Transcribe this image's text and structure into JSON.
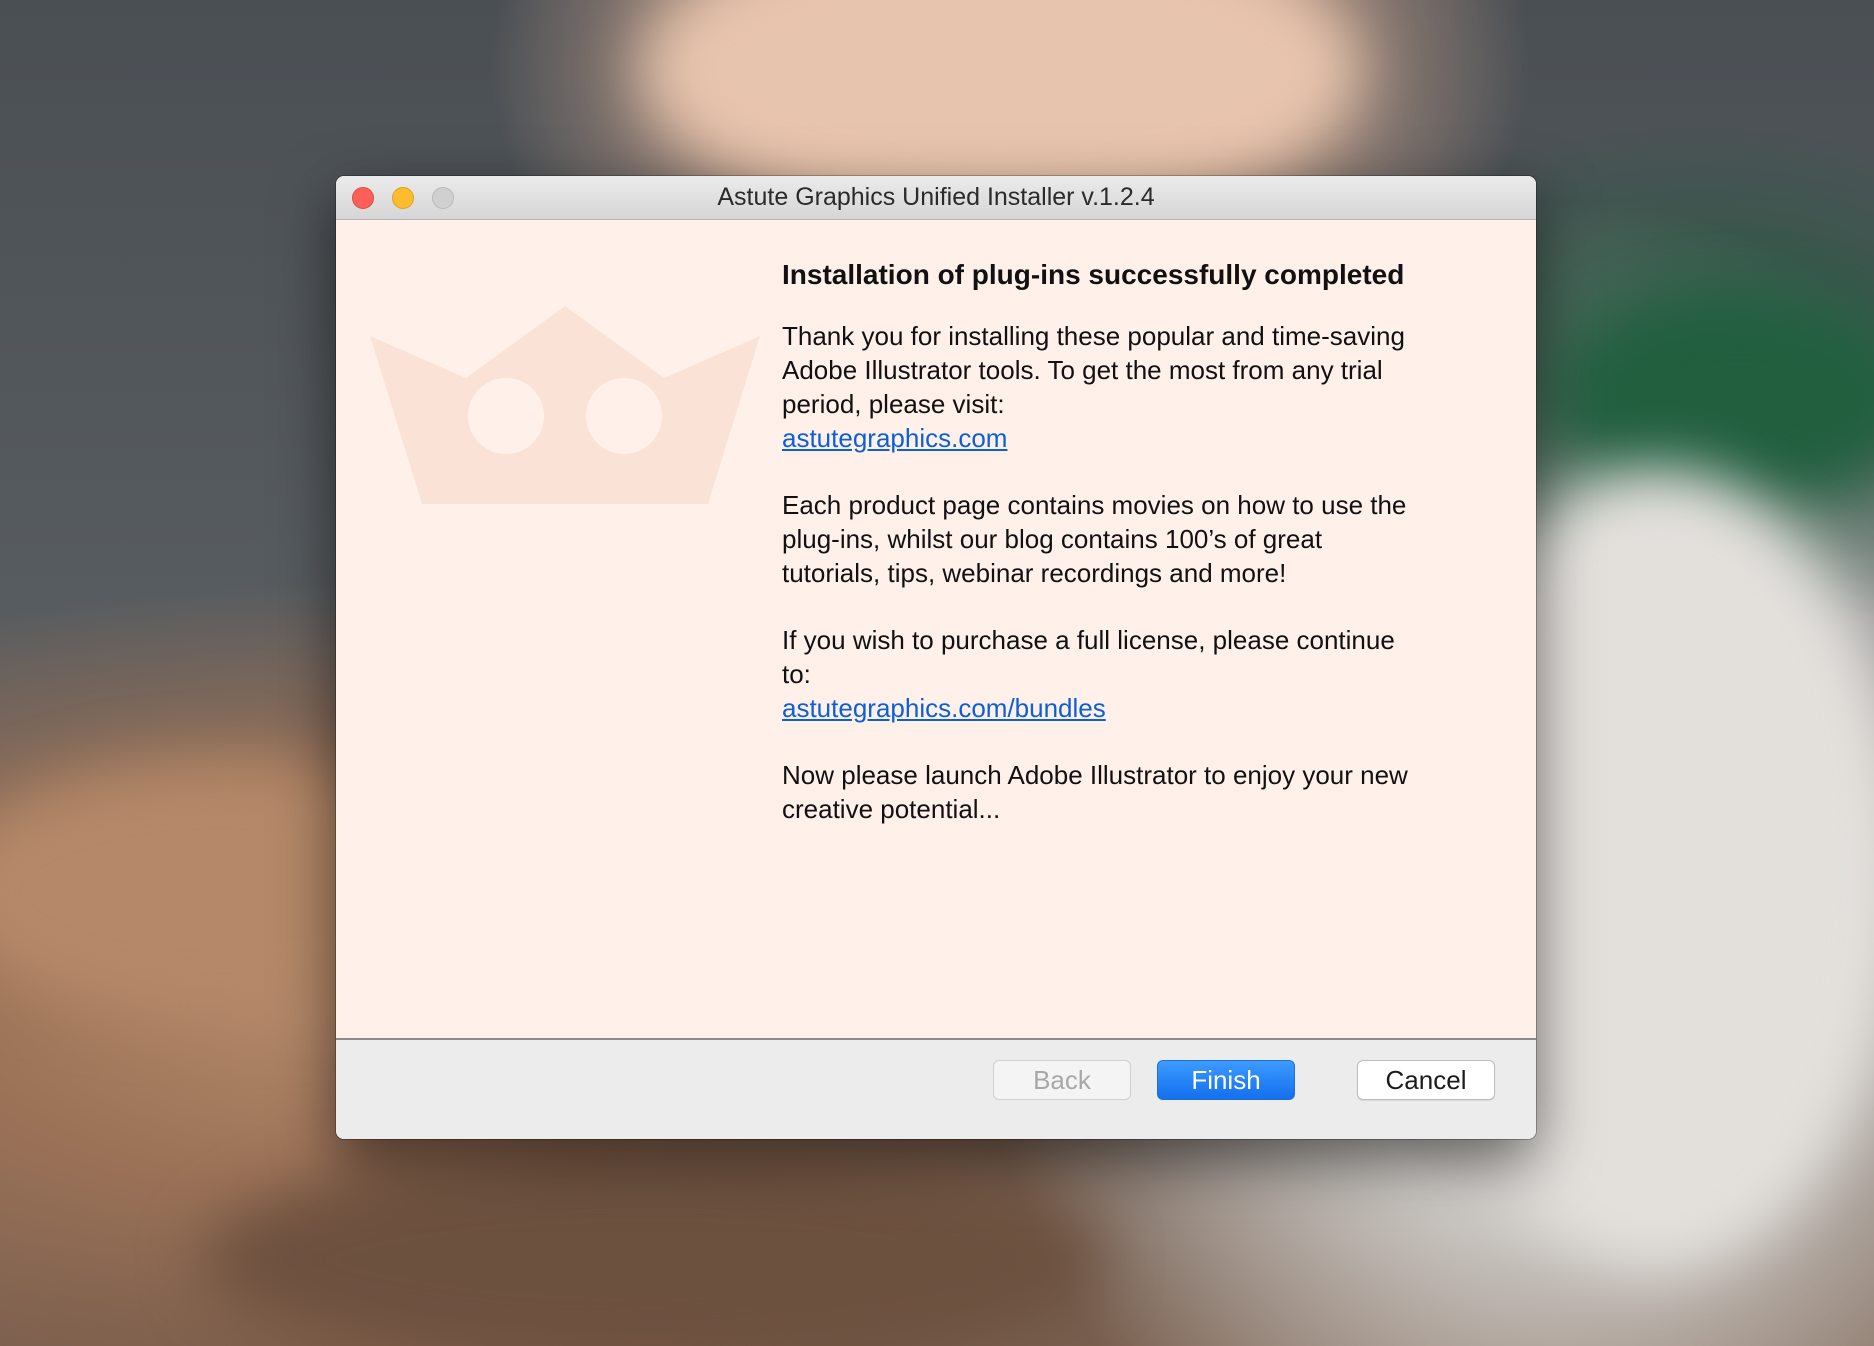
{
  "window": {
    "title": "Astute Graphics Unified Installer v.1.2.4"
  },
  "content": {
    "heading": "Installation of plug-ins successfully completed",
    "para1": "Thank you for installing these popular and time-saving Adobe Illustrator tools. To get the most from any trial period, please visit:",
    "link1": "astutegraphics.com",
    "para2": "Each product page contains movies on how to use the plug-ins, whilst our blog contains 100’s of great tutorials, tips, webinar recordings and more!",
    "para3": "If you wish to purchase a full license, please continue to:",
    "link2": "astutegraphics.com/bundles",
    "para4": "Now please launch Adobe Illustrator to enjoy your new creative potential..."
  },
  "buttons": {
    "back": "Back",
    "finish": "Finish",
    "cancel": "Cancel"
  },
  "colors": {
    "accent": "#136fef",
    "link": "#0c5fd6",
    "content_bg": "#fff1ea",
    "crown_watermark": "#fbe2d6"
  },
  "icons": {
    "watermark": "crown-icon"
  }
}
